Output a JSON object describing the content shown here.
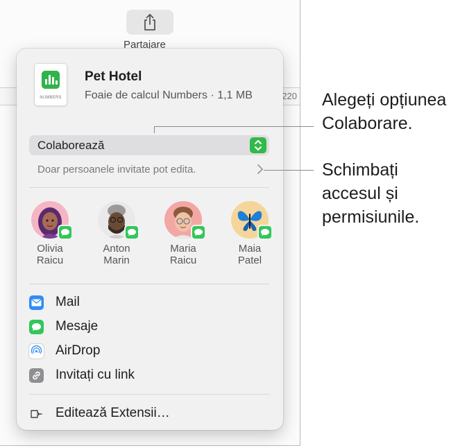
{
  "toolbar": {
    "share_label": "Partajare"
  },
  "ruler": {
    "mark": "220"
  },
  "file": {
    "title": "Pet Hotel",
    "subtitle": "Foaie de calcul Numbers · 1,1 MB",
    "icon_caption": "NUMBERS",
    "icon": "numbers-chart-icon"
  },
  "collaboration": {
    "selected": "Colaborează",
    "access_text": "Doar persoanele invitate pot edita."
  },
  "people": [
    {
      "first": "Olivia",
      "last": "Raicu"
    },
    {
      "first": "Anton",
      "last": "Marin"
    },
    {
      "first": "Maria",
      "last": "Raicu"
    },
    {
      "first": "Maia",
      "last": "Patel"
    }
  ],
  "share_options": [
    {
      "label": "Mail",
      "icon": "mail-icon"
    },
    {
      "label": "Mesaje",
      "icon": "messages-icon"
    },
    {
      "label": "AirDrop",
      "icon": "airdrop-icon"
    },
    {
      "label": "Invitați cu link",
      "icon": "link-icon"
    }
  ],
  "extensions": {
    "label": "Editează Extensii…",
    "icon": "extensions-icon"
  },
  "callouts": {
    "first": [
      "Alegeți opțiunea",
      "Colaborare."
    ],
    "second": [
      "Schimbați",
      "accesul și",
      "permisiunile."
    ]
  },
  "colors": {
    "accent_green": "#32b94a",
    "mail_blue": "#2f8cf5",
    "popover_bg": "#f1f1f2"
  }
}
